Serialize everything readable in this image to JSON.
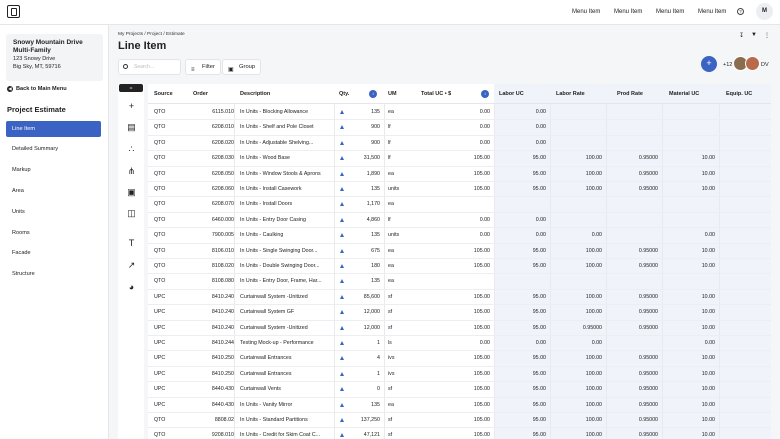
{
  "nav": {
    "menu_items": [
      "Menu Item",
      "Menu Item",
      "Menu Item",
      "Menu Item"
    ],
    "help_icon": "?",
    "avatar_initial": "M"
  },
  "project": {
    "name": "Snowy Mountain Drive Multi-Family",
    "address_line1": "123 Snowy Drive",
    "address_line2": "Big Sky, MT, 59716"
  },
  "sidebar": {
    "back_label": "Back to Main Menu",
    "section_title": "Project Estimate",
    "items": [
      "Line Item",
      "Detailed Summary",
      "Markup",
      "Area",
      "Units",
      "Rooms",
      "Facade",
      "Structure"
    ],
    "active_index": 0
  },
  "header": {
    "breadcrumb": "My Projects / Project / Estimate",
    "title": "Line Item",
    "search_placeholder": "Search...",
    "filter_label": "Filter",
    "group_label": "Group",
    "add_label": "+",
    "collab_count": "+12",
    "collab_initials": "DV"
  },
  "table": {
    "columns": [
      "Source",
      "Order",
      "Description",
      "Qty.",
      "UM",
      "Total UC • $",
      "Labor UC",
      "Labor Rate",
      "Prod Rate",
      "Material UC",
      "Equip. UC"
    ],
    "rows": [
      [
        "QTO",
        "6115.010",
        "In Units - Blocking Allowance",
        "135",
        "ea",
        "0.00",
        "0.00",
        "",
        "",
        "",
        ""
      ],
      [
        "QTO",
        "6208.010",
        "In Units - Shelf and Pole Closet",
        "900",
        "lf",
        "0.00",
        "0.00",
        "",
        "",
        "",
        ""
      ],
      [
        "QTO",
        "6208.020",
        "In Units - Adjustable Shelving...",
        "900",
        "lf",
        "0.00",
        "0.00",
        "",
        "",
        "",
        ""
      ],
      [
        "QTO",
        "6208.030",
        "In Units - Wood Base",
        "31,500",
        "lf",
        "105.00",
        "95.00",
        "100.00",
        "0.95000",
        "10.00",
        ""
      ],
      [
        "QTO",
        "6208.050",
        "In Units - Window Stools & Aprons",
        "1,890",
        "ea",
        "105.00",
        "95.00",
        "100.00",
        "0.95000",
        "10.00",
        ""
      ],
      [
        "QTO",
        "6208.060",
        "In Units - Install Casework",
        "135",
        "units",
        "105.00",
        "95.00",
        "100.00",
        "0.95000",
        "10.00",
        ""
      ],
      [
        "QTO",
        "6208.070",
        "In Units - Install Doors",
        "1,170",
        "ea",
        "",
        "",
        "",
        "",
        "",
        ""
      ],
      [
        "QTO",
        "6460.000",
        "In Units - Entry Door Casing",
        "4,860",
        "lf",
        "0.00",
        "0.00",
        "",
        "",
        "",
        ""
      ],
      [
        "QTO",
        "7900.005",
        "In Units - Caulking",
        "135",
        "units",
        "0.00",
        "0.00",
        "0.00",
        "",
        "0.00",
        ""
      ],
      [
        "QTO",
        "8106.010",
        "In Units - Single Swinging Door...",
        "675",
        "ea",
        "105.00",
        "95.00",
        "100.00",
        "0.95000",
        "10.00",
        ""
      ],
      [
        "QTO",
        "8108.020",
        "In Units - Double Swinging Door...",
        "180",
        "ea",
        "105.00",
        "95.00",
        "100.00",
        "0.95000",
        "10.00",
        ""
      ],
      [
        "QTO",
        "8108.080",
        "In Units - Entry Door, Frame, Har...",
        "135",
        "ea",
        "",
        "",
        "",
        "",
        "",
        ""
      ],
      [
        "UPC",
        "8410.240",
        "Curtainwall System -Unitized",
        "85,600",
        "sf",
        "105.00",
        "95.00",
        "100.00",
        "0.95000",
        "10.00",
        ""
      ],
      [
        "UPC",
        "8410.240",
        "Curtainwall System  GF",
        "12,000",
        "sf",
        "105.00",
        "95.00",
        "100.00",
        "0.95000",
        "10.00",
        ""
      ],
      [
        "UPC",
        "8410.240",
        "Curtainwall System -Unitized",
        "12,000",
        "sf",
        "105.00",
        "95.00",
        "0.95000",
        "0.95000",
        "10.00",
        ""
      ],
      [
        "UPC",
        "8410.244",
        "Testing Mock-up - Performance",
        "1",
        "ls",
        "0.00",
        "0.00",
        "0.00",
        "",
        "0.00",
        ""
      ],
      [
        "UPC",
        "8410.250",
        "Curtainwall Entrances",
        "4",
        "ivs",
        "105.00",
        "95.00",
        "100.00",
        "0.95000",
        "10.00",
        ""
      ],
      [
        "UPC",
        "8410.250",
        "Curtainwall Entrances",
        "1",
        "ivs",
        "105.00",
        "95.00",
        "100.00",
        "0.95000",
        "10.00",
        ""
      ],
      [
        "UPC",
        "8440.430",
        "Curtainwall Vents",
        "0",
        "sf",
        "105.00",
        "95.00",
        "100.00",
        "0.95000",
        "10.00",
        ""
      ],
      [
        "UPC",
        "8440.430",
        "In Units - Vanity Mirror",
        "135",
        "ea",
        "105.00",
        "95.00",
        "100.00",
        "0.95000",
        "10.00",
        ""
      ],
      [
        "QTO",
        "8808.02",
        "In Units - Standard Partitions",
        "137,250",
        "sf",
        "105.00",
        "95.00",
        "100.00",
        "0.95000",
        "10.00",
        ""
      ],
      [
        "QTO",
        "9208.010",
        "In Units - Credit for Skim Coat C...",
        "47,121",
        "sf",
        "105.00",
        "95.00",
        "100.00",
        "0.95000",
        "10.00",
        ""
      ]
    ]
  },
  "colors": {
    "accent": "#3b63c4",
    "shaded_columns": "#f0f3fa"
  }
}
